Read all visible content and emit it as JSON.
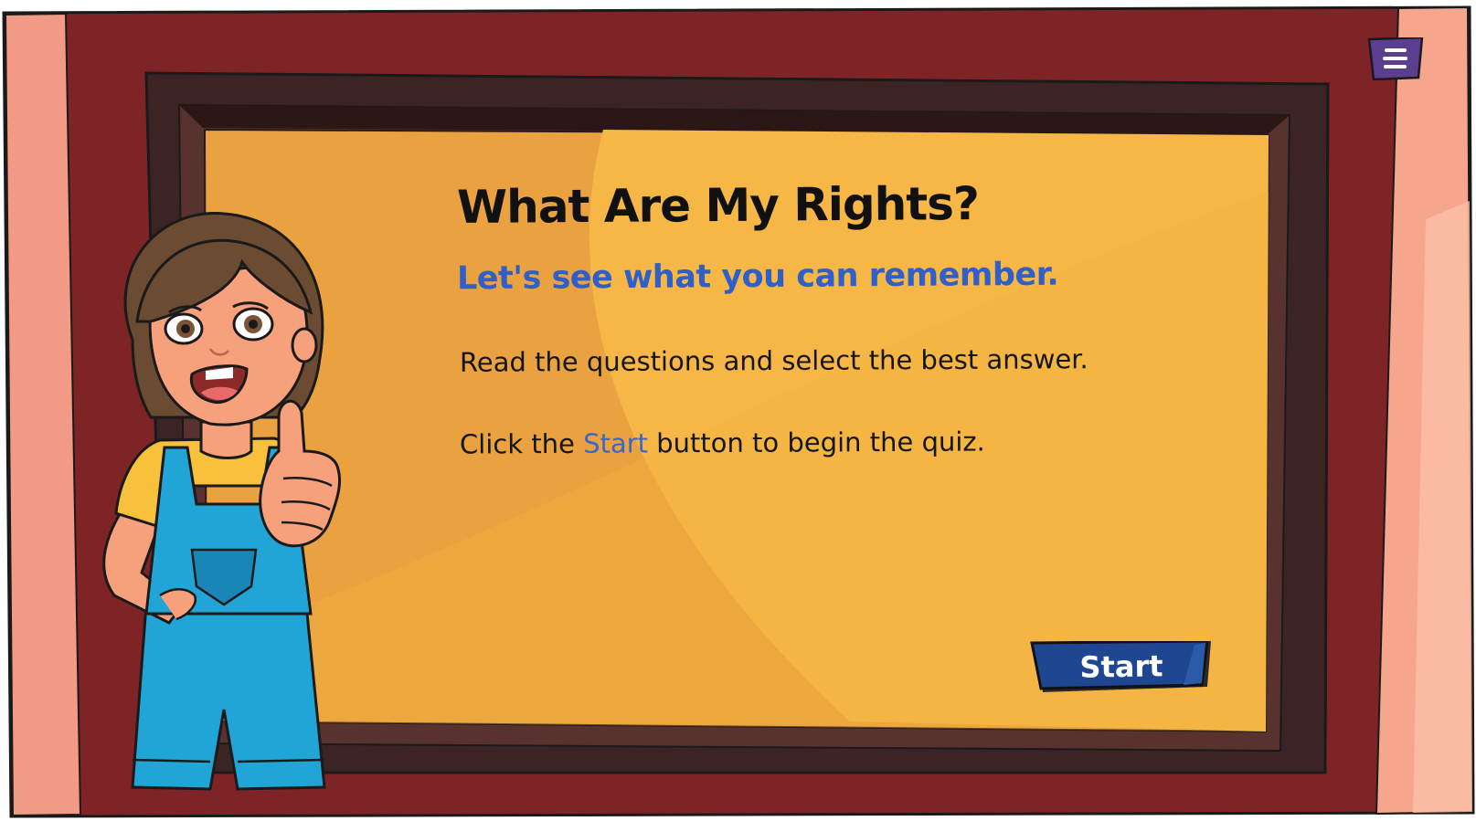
{
  "header": {
    "title": "What Are My Rights?",
    "subtitle": "Let's see what you can remember."
  },
  "instructions": {
    "line1": "Read the questions and select the best answer.",
    "line2_before": "Click the ",
    "line2_highlight": "Start",
    "line2_after": " button to begin the quiz."
  },
  "buttons": {
    "start_label": "Start"
  },
  "icons": {
    "menu": "hamburger-menu-icon",
    "character": "child-thumbs-up-character"
  },
  "colors": {
    "wall": "#7f2426",
    "board": "#f4b040",
    "title": "#111111",
    "subtitle": "#2f5fc7",
    "start_button": "#1f4690",
    "menu_button": "#5b3e8e"
  }
}
